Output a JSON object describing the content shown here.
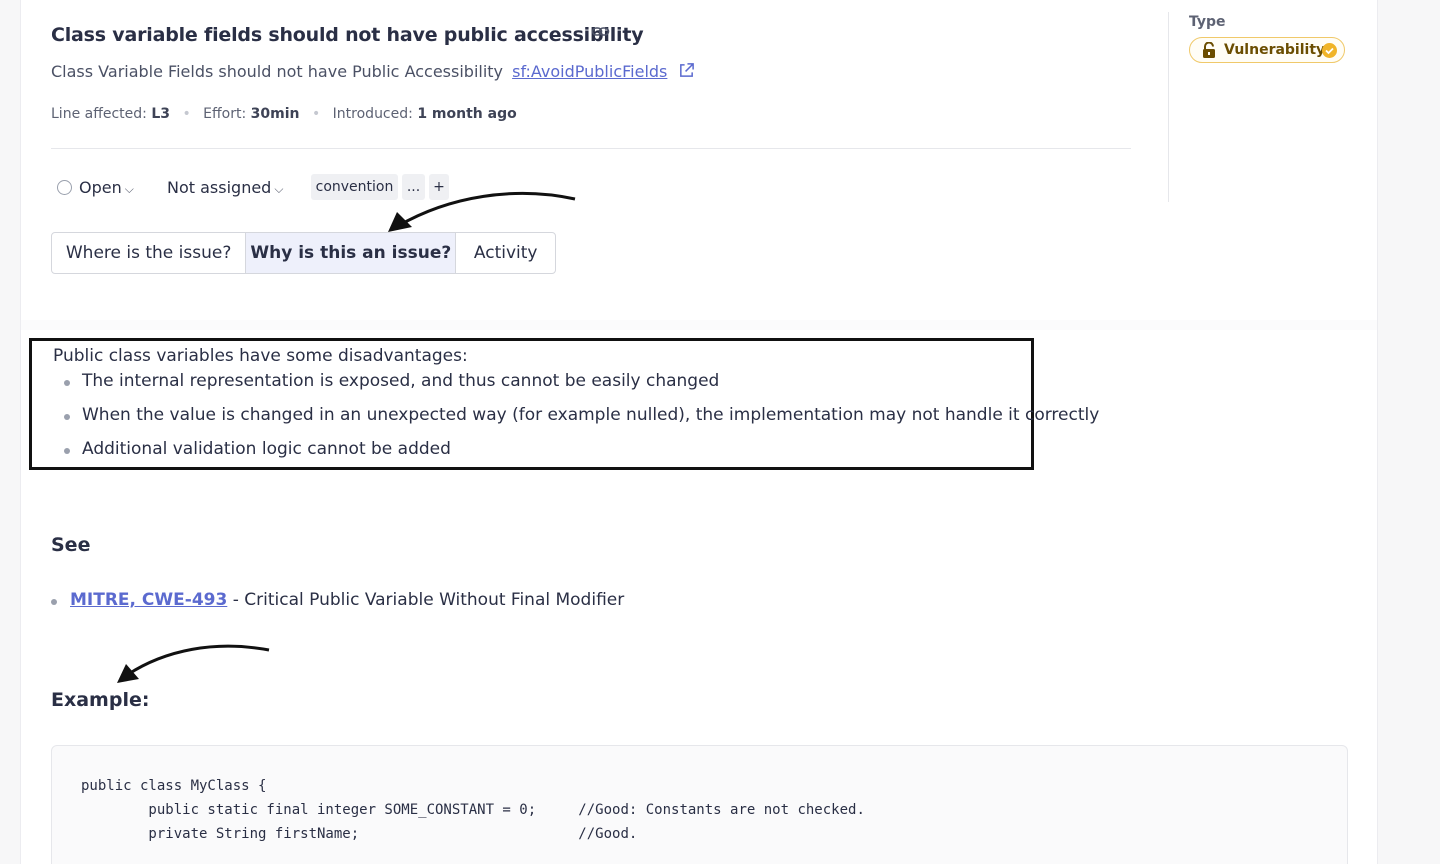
{
  "issue": {
    "title": "Class variable fields should not have public accessibility",
    "rule_description": "Class Variable Fields should not have Public Accessibility",
    "rule_key": "sf:AvoidPublicFields",
    "meta": {
      "line_label": "Line affected:",
      "line_value": "L3",
      "effort_label": "Effort:",
      "effort_value": "30min",
      "introduced_label": "Introduced:",
      "introduced_value": "1 month ago"
    }
  },
  "type_panel": {
    "label": "Type",
    "badge": "Vulnerability",
    "badge_color": "#f0c96a"
  },
  "status": {
    "status_value": "Open",
    "assignee": "Not assigned",
    "tags": [
      "convention",
      "...",
      "+"
    ]
  },
  "tabs": [
    {
      "label": "Where is the issue?",
      "active": false
    },
    {
      "label": "Why is this an issue?",
      "active": true
    },
    {
      "label": "Activity",
      "active": false
    }
  ],
  "description": {
    "intro": "Public class variables have some disadvantages:",
    "bullets": [
      "The internal representation is exposed, and thus cannot be easily changed",
      "When the value is changed in an unexpected way (for example nulled), the implementation may not handle it correctly",
      "Additional validation logic cannot be added"
    ]
  },
  "see": {
    "heading": "See",
    "link_text": "MITRE, CWE-493",
    "link_suffix": " - Critical Public Variable Without Final Modifier"
  },
  "example": {
    "heading": "Example:",
    "code_lines": [
      "public class MyClass {",
      "        public static final integer SOME_CONSTANT = 0;     //Good: Constants are not checked.",
      "        private String firstName;                          //Good."
    ]
  },
  "icons": {
    "link": "link-icon",
    "external": "external-link-icon",
    "lock": "lock-icon",
    "check": "check-circle-icon",
    "chevron": "chevron-down-icon"
  },
  "colors": {
    "accent": "#5b6acf",
    "active_tab_bg": "#eef0fb",
    "vulnerability": "#f0c96a"
  }
}
